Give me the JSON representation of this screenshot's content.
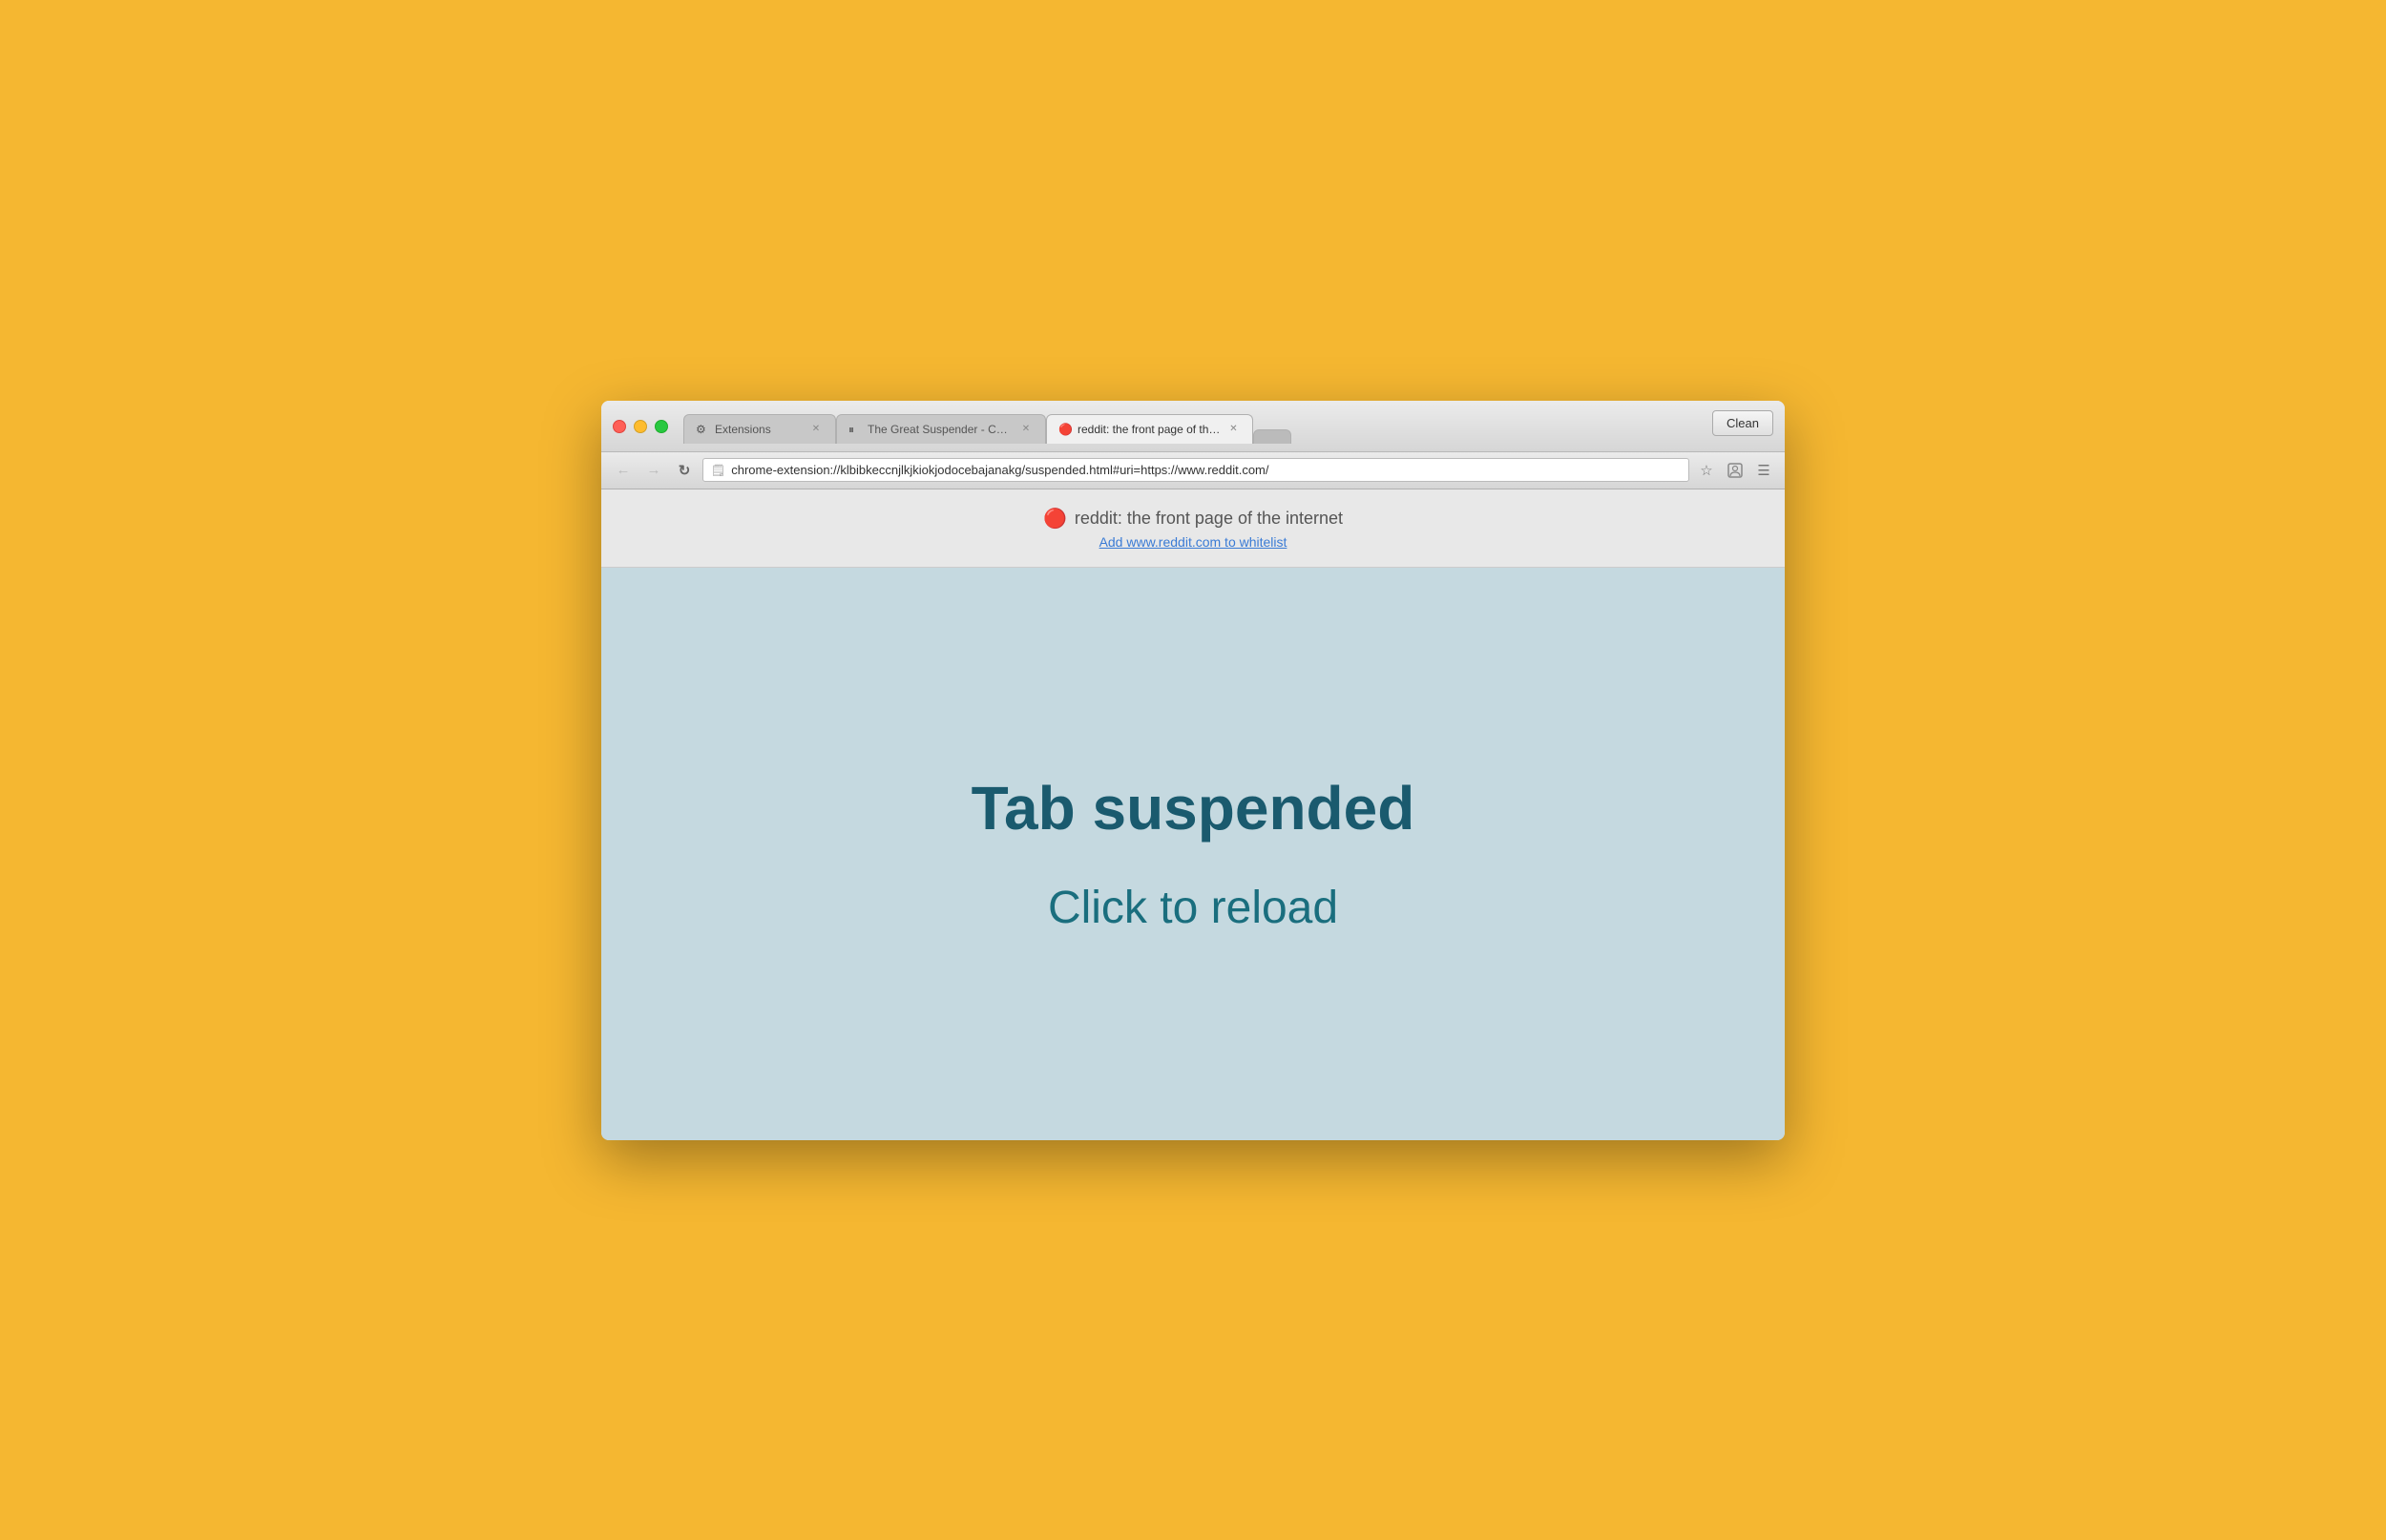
{
  "browser": {
    "clean_button_label": "Clean",
    "tabs": [
      {
        "id": "extensions",
        "label": "Extensions",
        "icon": "⚙",
        "active": false,
        "closeable": true
      },
      {
        "id": "great-suspender",
        "label": "The Great Suspender - Ch…",
        "icon": "⏸",
        "active": false,
        "closeable": true
      },
      {
        "id": "reddit",
        "label": "reddit: the front page of th…",
        "icon": "🔴",
        "active": true,
        "closeable": true
      },
      {
        "id": "blank",
        "label": "",
        "icon": "",
        "active": false,
        "closeable": false
      }
    ],
    "address_bar": {
      "url": "chrome-extension://klbibkeccnjlkjkiokjodocebajanakg/suspended.html#uri=https://www.reddit.com/"
    },
    "nav": {
      "back_disabled": false,
      "forward_disabled": true
    }
  },
  "page_header": {
    "site_icon": "🔴",
    "site_title": "reddit: the front page of the internet",
    "whitelist_link_text": "Add www.reddit.com to whitelist"
  },
  "page_content": {
    "suspended_heading": "Tab suspended",
    "reload_prompt": "Click to reload"
  }
}
